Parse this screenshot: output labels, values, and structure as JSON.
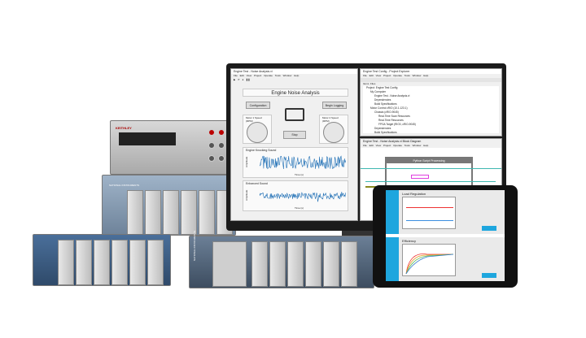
{
  "instruments": {
    "dmm_brand": "KEITHLEY",
    "pxi_brand": "NATIONAL INSTRUMENTS",
    "crio_brand": "NATIONAL INSTRUMENTS"
  },
  "front_panel": {
    "title": "Engine Test - Noise Analysis.vi",
    "menu": "File Edit View Project Operate Tools Window Help",
    "heading": "Engine Noise Analysis",
    "configuration_button": "Configuration",
    "begin_logging_button": "Begin Logging",
    "stop_button": "Stop",
    "gauge1_label": "Motor 1 Speed (RPM)",
    "gauge2_label": "Motor 2 Speed (RPM)",
    "graph1_title": "Engine Knocking Sound",
    "graph2_title": "Enhanced Sound",
    "x_label": "Time (s)",
    "y_label": "Amplitude"
  },
  "project_explorer": {
    "title": "Engine Test Config - Project Explorer",
    "menu": "File Edit View Project Operate Tools Window Help",
    "tabs": [
      "Items",
      "Files"
    ],
    "tree": [
      "Project: Engine Test Config",
      "My Computer",
      "Engine Test - Noise Analysis.vi",
      "Dependencies",
      "Build Specifications",
      "Motor Control cRIO (10.1.123.1)",
      "Chassis (cRIO-9045)",
      "Real-Time Scan Resources",
      "Real-Time Resources",
      "FPGA Target (RIO0, cRIO-9045)",
      "Dependencies",
      "Build Specifications"
    ]
  },
  "block_diagram": {
    "title": "Engine Test - Noise Analysis.vi Block Diagram",
    "menu": "File Edit View Project Operate Tools Window Help",
    "structure_label": "Python Script Processing"
  },
  "tablet": {
    "section1_title": "Load Regulation",
    "section2_title": "Efficiency"
  },
  "colors": {
    "accent": "#1ea6de",
    "wave": "#1f6fb5",
    "wire_teal": "#3fb8b0",
    "wire_olive": "#8a8a20"
  }
}
